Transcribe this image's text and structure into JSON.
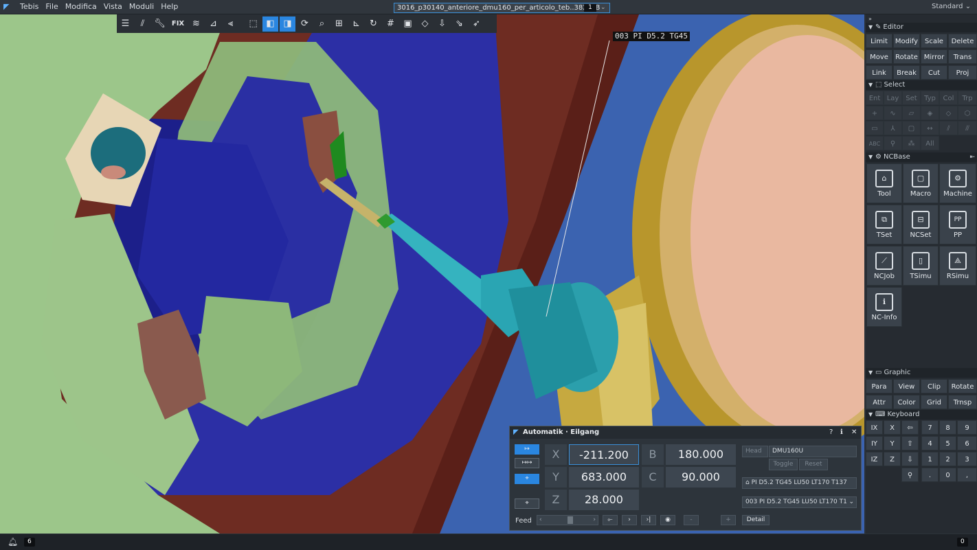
{
  "menubar": {
    "app_name": "Tebis",
    "items": [
      "File",
      "Modifica",
      "Vista",
      "Moduli",
      "Help"
    ],
    "file_tab": {
      "name": "3016_p30140_anteriore_dmu160_per_articolo_teb..382 MB",
      "number": "1"
    },
    "layout_select": "Standard"
  },
  "toolbar": {
    "fix_label": "FIX",
    "icons": [
      "list-icon",
      "lines-icon",
      "wrench-icon",
      "fix",
      "curves-icon",
      "surface-icon",
      "brush-icon",
      "cube-wire-icon",
      "cube-shaded-icon",
      "cube-transparent-icon",
      "refresh-icon",
      "zoom-icon",
      "zoom-box-icon",
      "axis-icon",
      "rotate-icon",
      "grid-icon",
      "frame-icon",
      "view-front-icon",
      "view-top-icon",
      "view-side-icon",
      "cursor-icon"
    ]
  },
  "viewport": {
    "tool_label": "003 PI D5.2 TG45"
  },
  "right_panel": {
    "collapse_glyph": "»",
    "editor": {
      "title": "Editor",
      "buttons": [
        "Limit",
        "Modify",
        "Scale",
        "Delete",
        "Move",
        "Rotate",
        "Mirror",
        "Trans",
        "Link",
        "Break",
        "Cut",
        "Proj"
      ]
    },
    "select": {
      "title": "Select",
      "row1": [
        "Ent",
        "Lay",
        "Set",
        "Typ",
        "Col",
        "Trp"
      ],
      "all_label": "All"
    },
    "ncbase": {
      "title": "NCBase",
      "buttons": [
        "Tool",
        "Macro",
        "Machine",
        "TSet",
        "NCSet",
        "PP",
        "NCJob",
        "TSimu",
        "RSimu",
        "NC-Info"
      ]
    },
    "graphic": {
      "title": "Graphic",
      "buttons": [
        "Para",
        "View",
        "Clip",
        "Rotate",
        "Attr",
        "Color",
        "Grid",
        "Trnsp"
      ]
    },
    "keyboard": {
      "title": "Keyboard",
      "row1": [
        "IX",
        "X",
        "⇦",
        "",
        "7",
        "8",
        "9"
      ],
      "row2": [
        "IY",
        "Y",
        "⇧",
        "",
        "4",
        "5",
        "6"
      ],
      "row3": [
        "IZ",
        "Z",
        "⇩",
        "",
        "1",
        "2",
        "3"
      ],
      "row4": [
        "",
        "",
        "⚲",
        "",
        ".",
        "0",
        ","
      ]
    }
  },
  "dialog": {
    "title": "Automatik · Eilgang",
    "controls": {
      "help": "?",
      "info": "ℹ",
      "close": "✕"
    },
    "axes": [
      {
        "label": "X",
        "value": "-211.200"
      },
      {
        "label": "Y",
        "value": "683.000"
      },
      {
        "label": "Z",
        "value": "28.000"
      },
      {
        "label": "B",
        "value": "180.000"
      },
      {
        "label": "C",
        "value": "90.000"
      }
    ],
    "head_label": "Head",
    "head_value": "DMU160U",
    "toggle_label": "Toggle",
    "reset_label": "Reset",
    "tool_field": "PI D5.2 TG45 LU50 LT170   T137",
    "tool_select": "003 PI D5.2 TG45 LU50 LT170   T1",
    "feed_label": "Feed",
    "detail_label": "Detail",
    "play_controls": [
      "⟜",
      "›",
      "›|",
      "◉",
      "-",
      "+"
    ]
  },
  "statusbar": {
    "left_count": "6",
    "right_count": "0"
  },
  "colors": {
    "accent": "#2a86e0",
    "part_green": "#8db87a",
    "fixture_blue": "#2a2fa3",
    "tool_cyan": "#27a7b5",
    "holder_gold": "#c8a83b",
    "machine_brown": "#6e2c22"
  }
}
